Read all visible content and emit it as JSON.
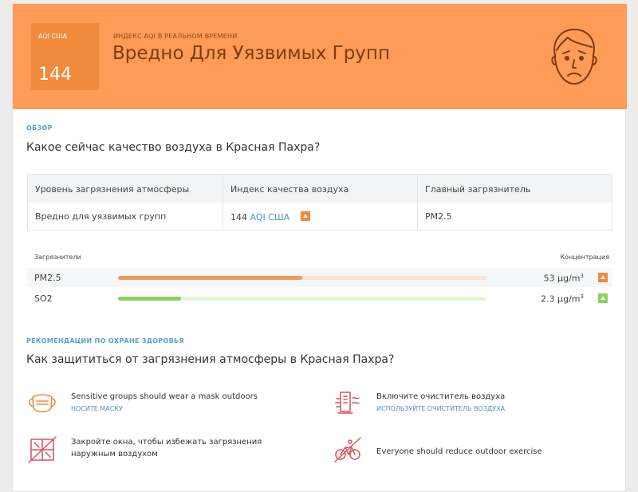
{
  "header": {
    "aqi_label": "AQI США",
    "aqi_value": "144",
    "subtitle": "Индекс AQI в реальном времени",
    "title": "Вредно Для Уязвимых Групп",
    "bg_color": "#fe9b57"
  },
  "overview": {
    "section_label": "Обзор",
    "question": "Какое сейчас качество воздуха в Красная Пахра?",
    "table": {
      "headers": [
        "Уровень загрязнения атмосферы",
        "Индекс качества воздуха",
        "Главный загрязнитель"
      ],
      "level": "Вредно для уязвимых групп",
      "aqi_number": "144",
      "aqi_unit": "AQI США",
      "main_pollutant": "PM2.5"
    }
  },
  "pollutants": {
    "header_left": "Загрязнители",
    "header_right": "Концентрация",
    "items": [
      {
        "name": "PM2.5",
        "value": "53",
        "unit": "μg/m",
        "unit_sup": "3",
        "level_fraction": 0.5,
        "fill_color": "#f29a5a",
        "track_color": "#f8e2d4",
        "trend": "up"
      },
      {
        "name": "SO2",
        "value": "2.3",
        "unit": "μg/m",
        "unit_sup": "3",
        "level_fraction": 0.17,
        "fill_color": "#8cd15c",
        "track_color": "#e4f4da",
        "trend": "up"
      }
    ]
  },
  "health": {
    "section_label": "Рекомендации по охране здоровья",
    "question": "Как защититься от загрязнения атмосферы в Красная Пахра?",
    "items": [
      {
        "icon": "mask-icon",
        "text": "Sensitive groups should wear a mask outdoors",
        "link": "Носите маску"
      },
      {
        "icon": "air-purifier-icon",
        "text": "Включите очиститель воздуха",
        "link": "Используйте очиститель воздуха"
      },
      {
        "icon": "window-closed-icon",
        "text": "Закройте окна, чтобы избежать загрязнения наружным воздухом",
        "link": ""
      },
      {
        "icon": "no-cycling-icon",
        "text": "Everyone should reduce outdoor exercise",
        "link": ""
      }
    ]
  }
}
